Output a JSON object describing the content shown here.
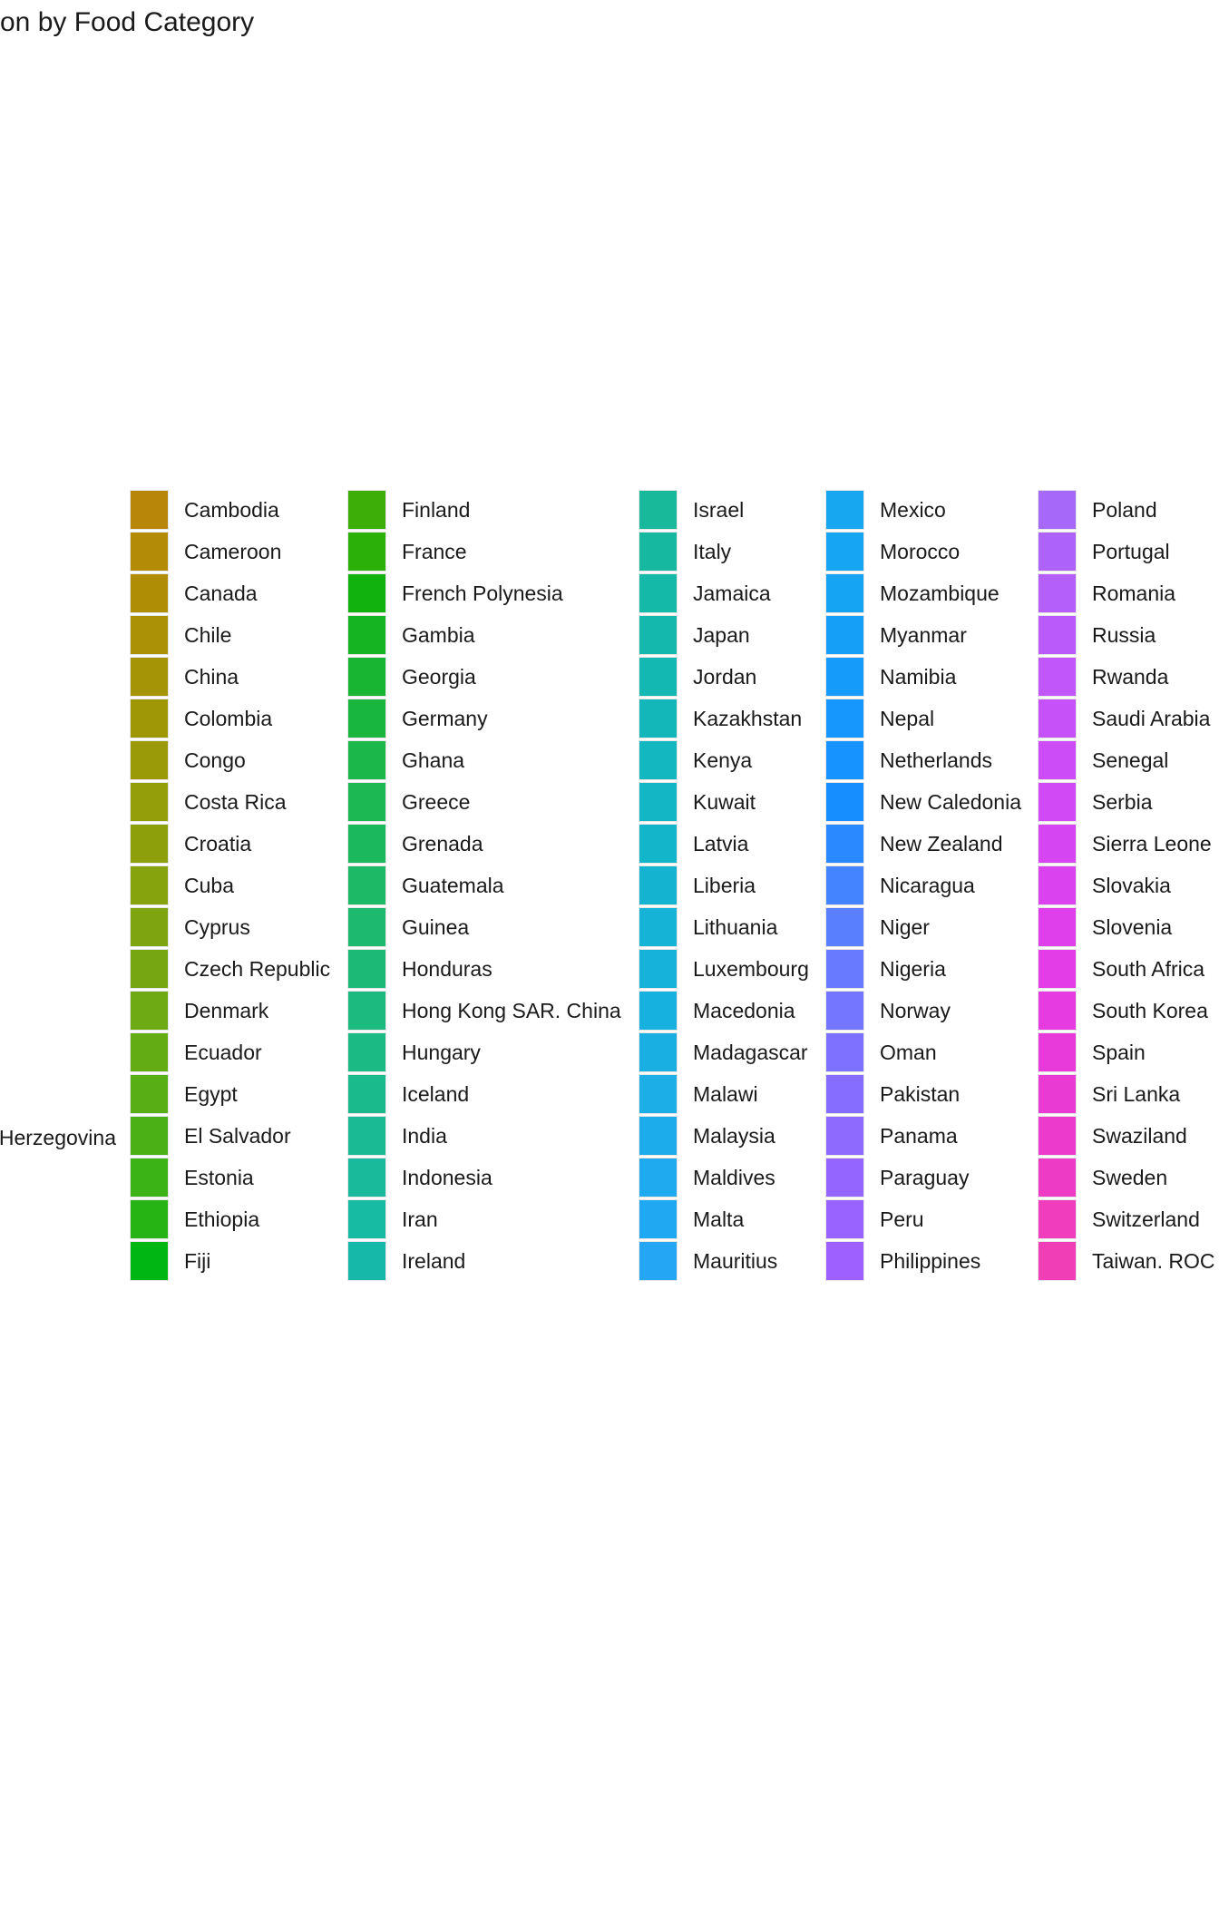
{
  "chart_data": {
    "type": "bar",
    "title": "on by Food Category",
    "legend": {
      "placement": "right",
      "cut_entry": "Herzegovina",
      "columns": [
        [
          "Cambodia",
          "Cameroon",
          "Canada",
          "Chile",
          "China",
          "Colombia",
          "Congo",
          "Costa Rica",
          "Croatia",
          "Cuba",
          "Cyprus",
          "Czech Republic",
          "Denmark",
          "Ecuador",
          "Egypt",
          "El Salvador",
          "Estonia",
          "Ethiopia",
          "Fiji"
        ],
        [
          "Finland",
          "France",
          "French Polynesia",
          "Gambia",
          "Georgia",
          "Germany",
          "Ghana",
          "Greece",
          "Grenada",
          "Guatemala",
          "Guinea",
          "Honduras",
          "Hong Kong SAR. China",
          "Hungary",
          "Iceland",
          "India",
          "Indonesia",
          "Iran",
          "Ireland"
        ],
        [
          "Israel",
          "Italy",
          "Jamaica",
          "Japan",
          "Jordan",
          "Kazakhstan",
          "Kenya",
          "Kuwait",
          "Latvia",
          "Liberia",
          "Lithuania",
          "Luxembourg",
          "Macedonia",
          "Madagascar",
          "Malawi",
          "Malaysia",
          "Maldives",
          "Malta",
          "Mauritius"
        ],
        [
          "Mexico",
          "Morocco",
          "Mozambique",
          "Myanmar",
          "Namibia",
          "Nepal",
          "Netherlands",
          "New Caledonia",
          "New Zealand",
          "Nicaragua",
          "Niger",
          "Nigeria",
          "Norway",
          "Oman",
          "Pakistan",
          "Panama",
          "Paraguay",
          "Peru",
          "Philippines"
        ],
        [
          "Poland",
          "Portugal",
          "Romania",
          "Russia",
          "Rwanda",
          "Saudi Arabia",
          "Senegal",
          "Serbia",
          "Sierra Leone",
          "Slovakia",
          "Slovenia",
          "South Africa",
          "South Korea",
          "Spain",
          "Sri Lanka",
          "Swaziland",
          "Sweden",
          "Switzerland",
          "Taiwan. ROC"
        ]
      ]
    },
    "colors": [
      [
        "#B8870A",
        "#B48B06",
        "#AF8E05",
        "#AA9105",
        "#A59405",
        "#A09706",
        "#9A9A08",
        "#949D0A",
        "#8DA00C",
        "#86A30E",
        "#7EA510",
        "#76A712",
        "#6DAA13",
        "#63AC14",
        "#58AE15",
        "#4BB015",
        "#3BB215",
        "#25B414",
        "#00B613"
      ],
      [
        "#3CAE07",
        "#2BB00A",
        "#12B20E",
        "#14B423",
        "#17B532",
        "#19B63F",
        "#1BB74A",
        "#1CB854",
        "#1CB85D",
        "#1DB966",
        "#1DB96E",
        "#1CB976",
        "#1CBA7E",
        "#1BBA85",
        "#1ABA8D",
        "#19BA94",
        "#18BA9B",
        "#17BAA2",
        "#16B9A9"
      ],
      [
        "#17B99A",
        "#16B9A0",
        "#15B9A7",
        "#14B8AD",
        "#14B8B3",
        "#13B7B9",
        "#13B7BF",
        "#13B6C5",
        "#13B5CA",
        "#14B4D0",
        "#15B3D5",
        "#16B2DA",
        "#17B1DF",
        "#19AFE3",
        "#1BAEE7",
        "#1DACEB",
        "#1FAAEF",
        "#21A8F2",
        "#24A6F5"
      ],
      [
        "#16A7F0",
        "#15A5F2",
        "#15A3F4",
        "#159FF7",
        "#159BFA",
        "#1697FD",
        "#1693FF",
        "#168EFF",
        "#2A89FF",
        "#4584FF",
        "#597FFF",
        "#687AFF",
        "#7576FF",
        "#7F71FF",
        "#876DFF",
        "#8E6AFF",
        "#9466FF",
        "#9963FF",
        "#9E61FF"
      ],
      [
        "#A668F8",
        "#AD63F9",
        "#B45FFA",
        "#BB5AFA",
        "#C156FA",
        "#C751F9",
        "#CC4DF7",
        "#D149F5",
        "#D645F2",
        "#DA42EF",
        "#DE3FEB",
        "#E23DE6",
        "#E53BE1",
        "#E83ADB",
        "#EA3AD4",
        "#EC3ACD",
        "#EE3BC6",
        "#EF3DBE",
        "#F03FB6"
      ]
    ]
  }
}
